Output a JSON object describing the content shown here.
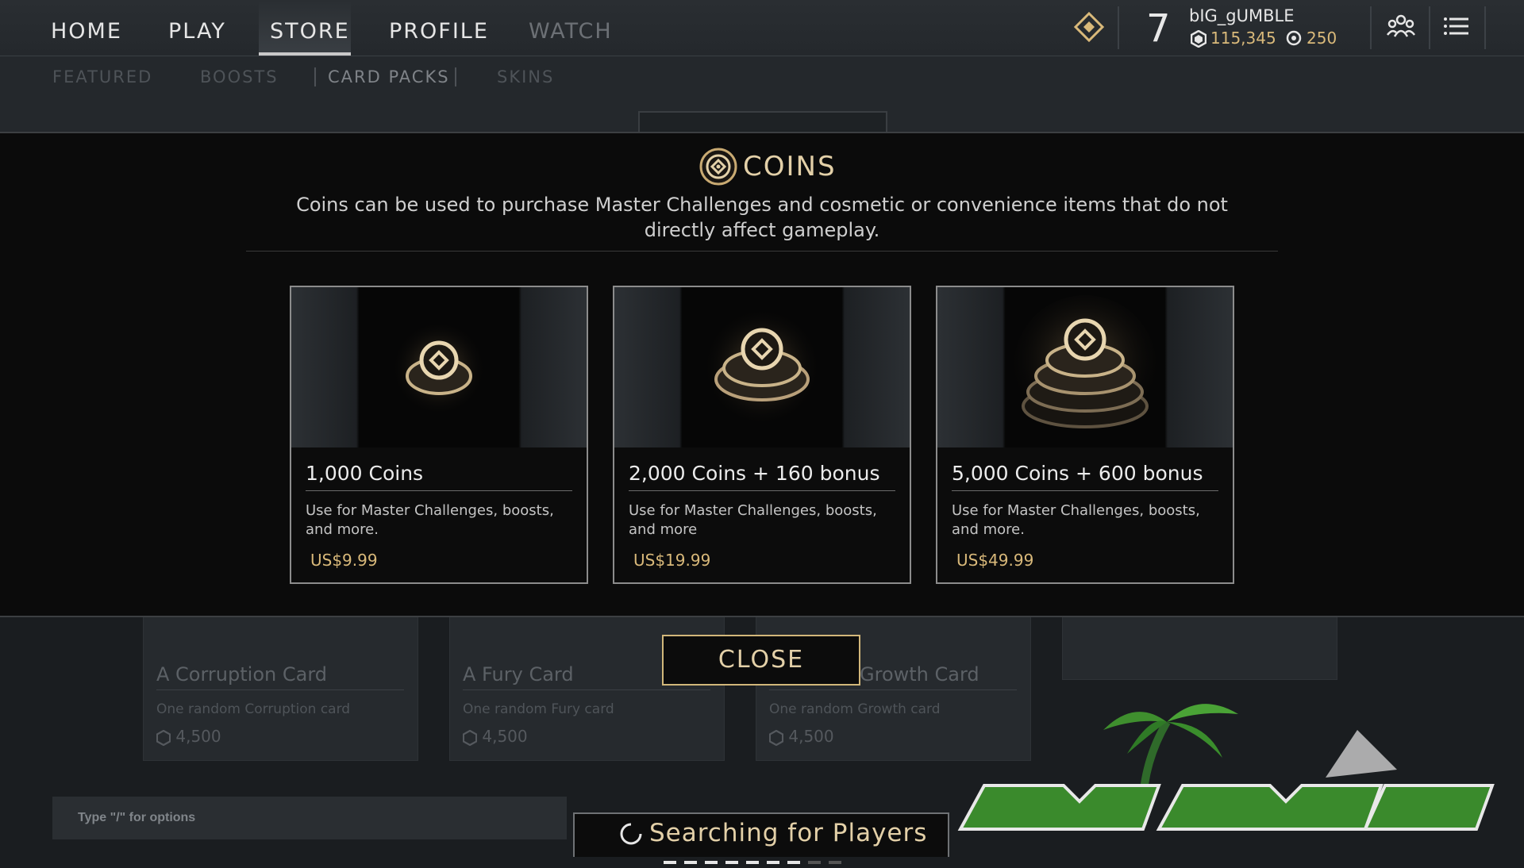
{
  "nav": {
    "items": [
      {
        "label": "HOME"
      },
      {
        "label": "PLAY"
      },
      {
        "label": "STORE"
      },
      {
        "label": "PROFILE"
      },
      {
        "label": "WATCH"
      }
    ],
    "active": "STORE"
  },
  "player": {
    "level": "7",
    "username": "bIG_gUMBLE",
    "gold": "115,345",
    "coins": "250"
  },
  "subnav": {
    "items": [
      {
        "label": "FEATURED"
      },
      {
        "label": "BOOSTS"
      },
      {
        "label": "CARD PACKS"
      },
      {
        "label": "SKINS"
      }
    ]
  },
  "modal": {
    "title": "COINS",
    "description": "Coins can be used to purchase Master Challenges and cosmetic or convenience items that do not directly affect gameplay.",
    "offers": [
      {
        "name": "1,000 Coins",
        "description": "Use for Master Challenges, boosts, and more.",
        "price": "US$9.99"
      },
      {
        "name": "2,000 Coins + 160 bonus",
        "description": "Use for Master Challenges, boosts, and more",
        "price": "US$19.99"
      },
      {
        "name": "5,000 Coins + 600 bonus",
        "description": "Use for Master Challenges, boosts, and more.",
        "price": "US$49.99"
      }
    ],
    "close_label": "CLOSE"
  },
  "background_cards": [
    {
      "name": "A Corruption Card",
      "description": "One random Corruption card",
      "price": "4,500"
    },
    {
      "name": "A Fury Card",
      "description": "One random Fury card",
      "price": "4,500"
    },
    {
      "name": "Growth Card",
      "description": "One random Growth card",
      "price": "4,500"
    }
  ],
  "chat": {
    "placeholder": "Type \"/\" for options"
  },
  "matchmaking": {
    "status": "Searching for Players"
  },
  "colors": {
    "accent_gold": "#d9b97a",
    "modal_bg": "#0b0b0b",
    "title_gold": "#e3d0a8"
  }
}
